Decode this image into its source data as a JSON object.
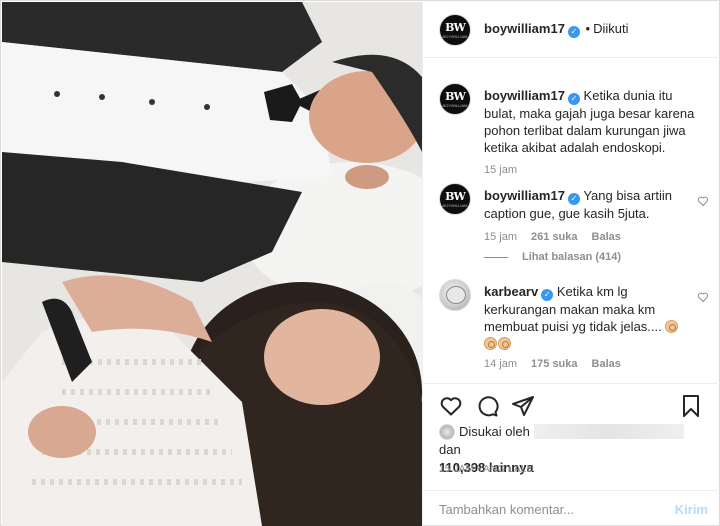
{
  "post": {
    "author": "boywilliam17",
    "follow_status": "Diikuti",
    "avatar_text": "BW",
    "avatar_subtext": "BOYWILLIAM"
  },
  "comments": [
    {
      "username": "boywilliam17",
      "text": "Ketika dunia itu bulat, maka gajah juga besar karena pohon terlibat dalam kurungan jiwa ketika akibat adalah endoskopi.",
      "time": "15 jam"
    },
    {
      "username": "boywilliam17",
      "text": "Yang bisa artiin caption gue, gue kasih 5juta.",
      "time": "15 jam",
      "likes": "261 suka",
      "reply": "Balas",
      "view_replies": "Lihat balasan (414)"
    },
    {
      "username": "karbearv",
      "text": "Ketika km lg kerkurangan makan maka km membuat puisi yg tidak jelas....",
      "time": "14 jam",
      "likes": "175 suka",
      "reply": "Balas"
    }
  ],
  "actions": {
    "liked_by_prefix": "Disukai oleh",
    "liked_by_suffix": "dan",
    "others_count": "110,398 lainnya",
    "time_ago": "15 JAM YANG LALU"
  },
  "add_comment": {
    "placeholder": "Tambahkan komentar...",
    "post_label": "Kirim"
  },
  "colors": {
    "verified": "#3897f0",
    "muted": "#8e8e8e",
    "post_disabled": "#b3dbff"
  }
}
